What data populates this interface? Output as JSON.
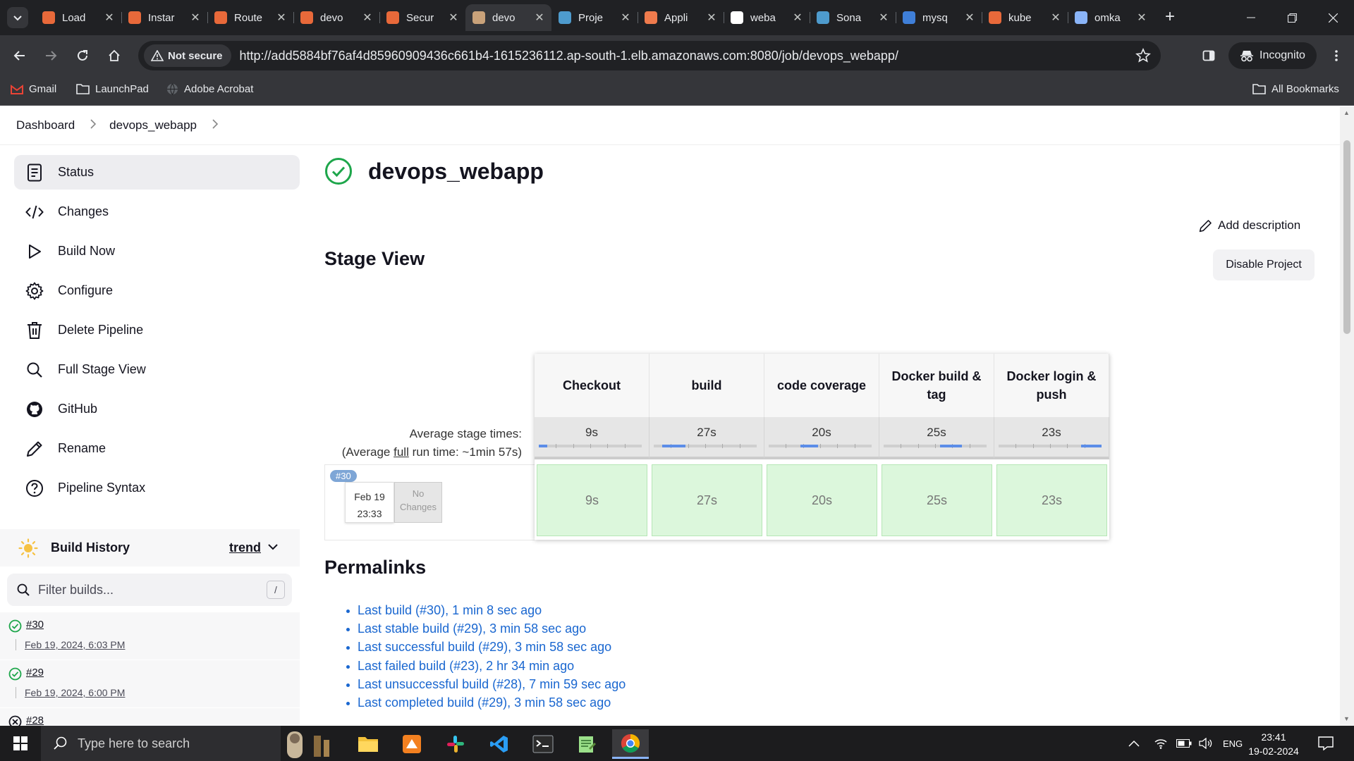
{
  "browser": {
    "tabs": [
      {
        "title": "Load",
        "favicon": "aws-icon",
        "color": "#e8693a"
      },
      {
        "title": "Instar",
        "favicon": "aws-icon",
        "color": "#e8693a"
      },
      {
        "title": "Route",
        "favicon": "aws-icon",
        "color": "#e8693a"
      },
      {
        "title": "devo",
        "favicon": "aws-icon",
        "color": "#e8693a"
      },
      {
        "title": "Secur",
        "favicon": "aws-icon",
        "color": "#e8693a"
      },
      {
        "title": "devo",
        "favicon": "jenkins-icon",
        "color": "#c9a27a"
      },
      {
        "title": "Proje",
        "favicon": "sonar-icon",
        "color": "#4e9bcd"
      },
      {
        "title": "Appli",
        "favicon": "argo-icon",
        "color": "#ef7b4d"
      },
      {
        "title": "weba",
        "favicon": "github-icon",
        "color": "#ffffff"
      },
      {
        "title": "Sona",
        "favicon": "sonar-icon",
        "color": "#4e9bcd"
      },
      {
        "title": "mysq",
        "favicon": "kube-icon",
        "color": "#3f7fd8"
      },
      {
        "title": "kube",
        "favicon": "jenkins-icon",
        "color": "#e8693a"
      },
      {
        "title": "omka",
        "favicon": "globe-icon",
        "color": "#8ab4f8"
      }
    ],
    "active_tab_index": 5,
    "security_label": "Not secure",
    "url": "http://add5884bf76af4d85960909436c661b4-1615236112.ap-south-1.elb.amazonaws.com:8080/job/devops_webapp/",
    "incognito_label": "Incognito",
    "bookmarks": [
      {
        "label": "Gmail"
      },
      {
        "label": "LaunchPad"
      },
      {
        "label": "Adobe Acrobat"
      }
    ],
    "all_bookmarks_label": "All Bookmarks"
  },
  "breadcrumb": [
    "Dashboard",
    "devops_webapp"
  ],
  "sidebar": {
    "items": [
      {
        "label": "Status",
        "icon": "document-icon"
      },
      {
        "label": "Changes",
        "icon": "code-icon"
      },
      {
        "label": "Build Now",
        "icon": "play-icon"
      },
      {
        "label": "Configure",
        "icon": "gear-icon"
      },
      {
        "label": "Delete Pipeline",
        "icon": "trash-icon"
      },
      {
        "label": "Full Stage View",
        "icon": "search-icon"
      },
      {
        "label": "GitHub",
        "icon": "github-icon"
      },
      {
        "label": "Rename",
        "icon": "pencil-icon"
      },
      {
        "label": "Pipeline Syntax",
        "icon": "help-icon"
      }
    ]
  },
  "build_history": {
    "title": "Build History",
    "trend_label": "trend",
    "filter_placeholder": "Filter builds...",
    "filter_shortcut": "/",
    "builds": [
      {
        "number": "#30",
        "date": "Feb 19, 2024, 6:03 PM",
        "status": "success"
      },
      {
        "number": "#29",
        "date": "Feb 19, 2024, 6:00 PM",
        "status": "success"
      },
      {
        "number": "#28",
        "date": "",
        "status": "failed"
      }
    ]
  },
  "job": {
    "title": "devops_webapp",
    "add_description_label": "Add description",
    "disable_label": "Disable Project"
  },
  "stage_view": {
    "heading": "Stage View",
    "avg_stage_label": "Average stage times:",
    "avg_run_prefix": "(Average ",
    "avg_run_full": "full",
    "avg_run_suffix": " run time: ~1min 57s)",
    "stages": [
      {
        "name": "Checkout",
        "avg": "9s",
        "bar_start": 0.0,
        "bar_fraction": 0.08
      },
      {
        "name": "build",
        "avg": "27s",
        "bar_start": 0.08,
        "bar_fraction": 0.23
      },
      {
        "name": "code coverage",
        "avg": "20s",
        "bar_start": 0.31,
        "bar_fraction": 0.17
      },
      {
        "name": "Docker build & tag",
        "avg": "25s",
        "bar_start": 0.55,
        "bar_fraction": 0.21
      },
      {
        "name": "Docker login & push",
        "avg": "23s",
        "bar_start": 0.8,
        "bar_fraction": 0.2
      }
    ],
    "run": {
      "badge": "#30",
      "date": "Feb 19",
      "time": "23:33",
      "changes_line1": "No",
      "changes_line2": "Changes",
      "durations": [
        "9s",
        "27s",
        "20s",
        "25s",
        "23s"
      ]
    },
    "colors": {
      "success_cell": "#dcf7dc",
      "bar": "#5c8de8"
    }
  },
  "permalinks": {
    "heading": "Permalinks",
    "links": [
      "Last build (#30), 1 min 8 sec ago",
      "Last stable build (#29), 3 min 58 sec ago",
      "Last successful build (#29), 3 min 58 sec ago",
      "Last failed build (#23), 2 hr 34 min ago",
      "Last unsuccessful build (#28), 7 min 59 sec ago",
      "Last completed build (#29), 3 min 58 sec ago"
    ]
  },
  "taskbar": {
    "search_placeholder": "Type here to search",
    "language": "ENG",
    "time": "23:41",
    "date": "19-02-2024"
  }
}
